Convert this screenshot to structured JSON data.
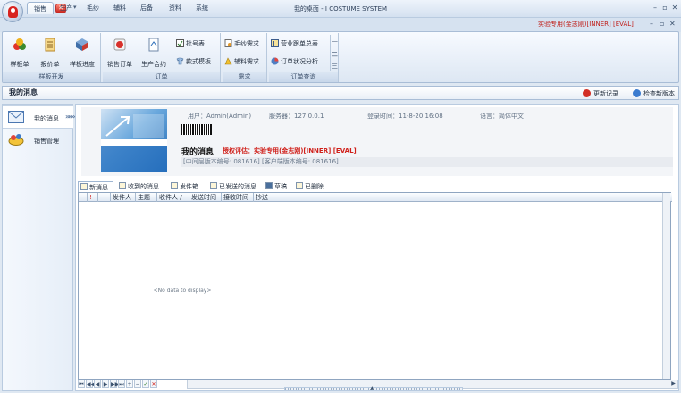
{
  "window": {
    "title": "我的桌面 - I COSTUME SYSTEM",
    "minimize": "–",
    "maximize": "▫",
    "close": "✕",
    "qa_dropdown": "▾"
  },
  "ribbon_tabs": [
    {
      "label": "销售"
    },
    {
      "label": "生产"
    },
    {
      "label": "毛纱"
    },
    {
      "label": "辅料"
    },
    {
      "label": "后备"
    },
    {
      "label": "资料"
    },
    {
      "label": "系统"
    }
  ],
  "license_banner": "实验专用(金志刚)[INNER] [EVAL]",
  "mdi": {
    "minimize": "–",
    "restore": "▫",
    "close": "✕"
  },
  "ribbon": {
    "groups": [
      {
        "label": "样板开发"
      },
      {
        "label": "订单"
      },
      {
        "label": "需求"
      },
      {
        "label": "订单查询"
      }
    ],
    "buttons": {
      "sample_order": "样板单",
      "quote": "报价单",
      "sample_progress": "样板进度",
      "sales_order": "销售订单",
      "production_contract": "生产合约",
      "approval_form": "批号表",
      "style_template": "款式模板",
      "yarn_demand": "毛纱需求",
      "accessory_demand": "辅料需求",
      "business_summary": "营业跟单总表",
      "order_status": "订单状况分析"
    },
    "gallery": {
      "up": "—",
      "mid": "二",
      "down": "三"
    }
  },
  "page": {
    "title": "我的消息",
    "update_log": "更新记录",
    "check_version": "检查新版本"
  },
  "nav": {
    "items": [
      {
        "label": "我的消息",
        "arrow": "»»»"
      },
      {
        "label": "销售管理"
      }
    ]
  },
  "info": {
    "user": "用户：Admin(Admin)",
    "server": "服务器：127.0.0.1",
    "login_time": "登录时间：11-8-20 16:08",
    "language": "语言：简体中文",
    "title": "我的消息",
    "license": "授权评估：实验专用(金志刚)[INNER] [EVAL]",
    "versions": "[中间层版本编号: 081616]  [客户端版本编号: 081616]"
  },
  "message_tabs": [
    {
      "label": "新消息"
    },
    {
      "label": "收到的消息"
    },
    {
      "label": "发件箱"
    },
    {
      "label": "已发送的消息"
    },
    {
      "label": "草稿"
    },
    {
      "label": "已删除"
    }
  ],
  "grid": {
    "columns": [
      "",
      "!",
      "",
      "发件人",
      "主题",
      "收件人 /",
      "发送时间",
      "接收时间",
      "抄送"
    ],
    "empty_text": "<No data to display>"
  },
  "navigator": [
    "⏮",
    "◀◀",
    "◀",
    "▶",
    "▶▶",
    "⏭",
    "+",
    "−",
    "✓",
    "✕"
  ],
  "colors": {
    "accent": "#c0211b",
    "ribbon": "#dde7f3",
    "border": "#a9bdd6"
  }
}
